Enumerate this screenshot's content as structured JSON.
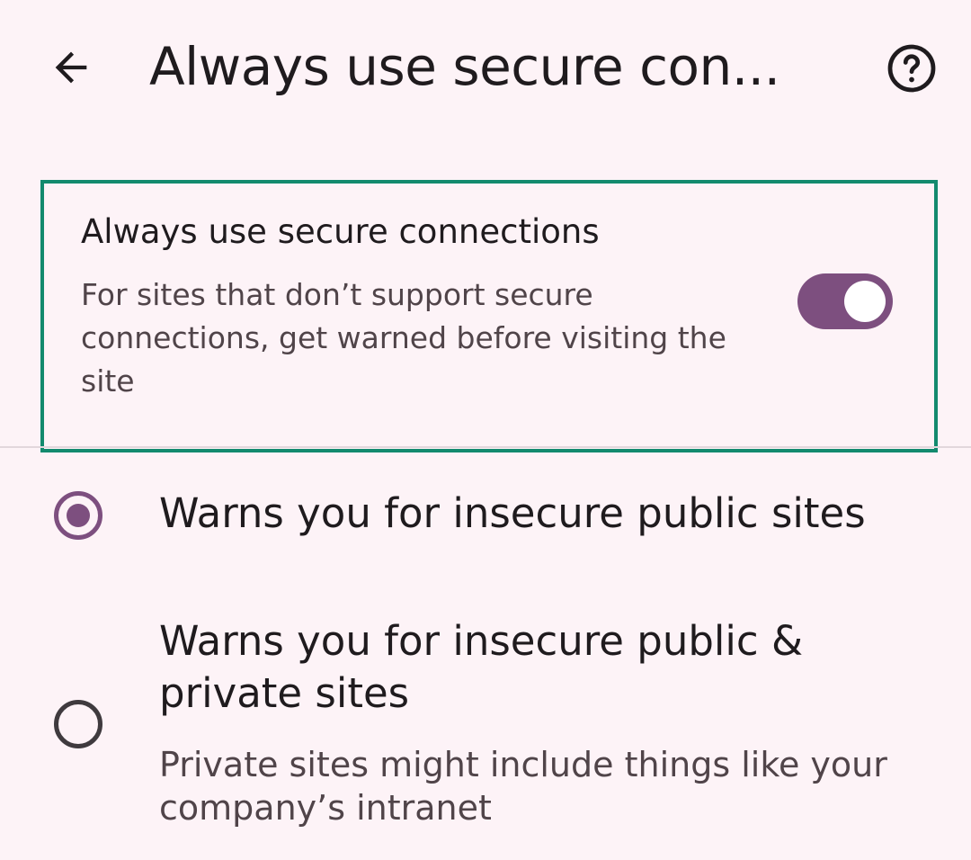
{
  "header": {
    "title": "Always use secure con...",
    "back_icon": "arrow-left-icon",
    "help_icon": "help-circle-icon"
  },
  "setting": {
    "title": "Always use secure connections",
    "summary": "For sites that don’t support secure connections, get warned before visiting the site",
    "toggle_on": true
  },
  "options": [
    {
      "label": "Warns you for insecure public sites",
      "selected": true
    },
    {
      "label": "Warns you for insecure public & private sites",
      "description": "Private sites might include things like your company’s intranet",
      "selected": false
    }
  ],
  "colors": {
    "accent": "#7d4f7f",
    "highlight_border": "#138a6e",
    "background": "#fdf3f7"
  }
}
